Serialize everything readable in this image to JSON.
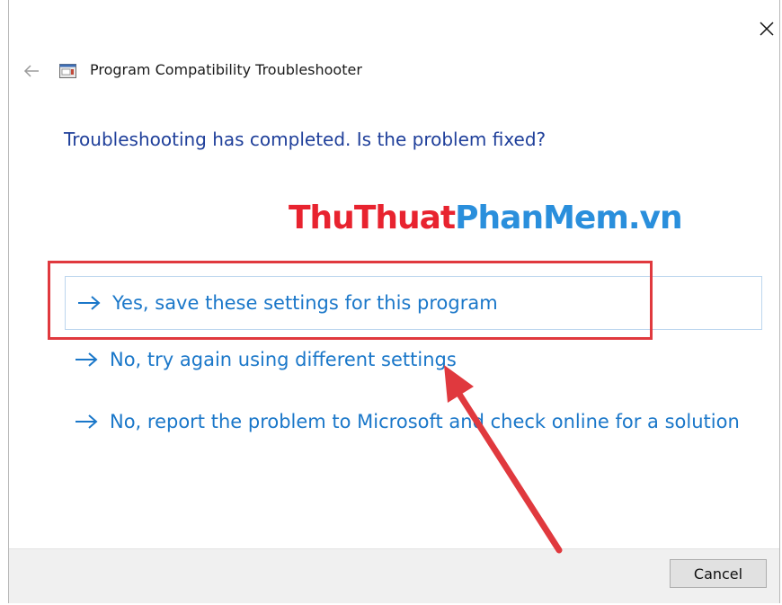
{
  "window": {
    "title": "Program Compatibility Troubleshooter",
    "icons": {
      "close": "close-icon",
      "back": "back-arrow-icon",
      "app": "troubleshooter-app-icon"
    }
  },
  "content": {
    "heading": "Troubleshooting has completed.  Is the problem fixed?",
    "options": [
      {
        "label": "Yes, save these settings for this program",
        "icon": "right-arrow-icon",
        "selected": true
      },
      {
        "label": "No, try again using different settings",
        "icon": "right-arrow-icon",
        "selected": false
      },
      {
        "label": "No, report the problem to Microsoft and check online for a solution",
        "icon": "right-arrow-icon",
        "selected": false
      }
    ]
  },
  "footer": {
    "cancel_label": "Cancel"
  },
  "overlay": {
    "watermark_part1": "ThuThuat",
    "watermark_part2": "PhanMem.vn",
    "highlight_color": "#e0393e",
    "annotation_arrow_color": "#e0393e"
  },
  "colors": {
    "heading": "#1f3f9a",
    "link": "#1a77c9",
    "footer_bg": "#f0f0f0"
  }
}
